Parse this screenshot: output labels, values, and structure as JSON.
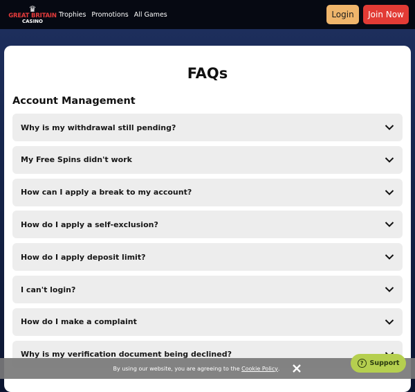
{
  "header": {
    "logo_line1": "GREAT BRITAIN",
    "logo_line2": "CASINO",
    "nav": [
      "Trophies",
      "Promotions",
      "All Games"
    ],
    "login": "Login",
    "join": "Join Now"
  },
  "main": {
    "title": "FAQs",
    "section": "Account Management",
    "faqs": [
      "Why is my withdrawal still pending?",
      "My Free Spins didn't work",
      "How can I apply a break to my account?",
      "How do I apply a self-exclusion?",
      "How do I apply deposit limit?",
      "I can't login?",
      "How do I make a complaint",
      "Why is my verification document being declined?"
    ]
  },
  "cookie": {
    "text": "By using our website, you are agreeing to the ",
    "link": "Cookie Policy",
    "end": "."
  },
  "support": {
    "label": "Support",
    "icon": "?"
  },
  "colors": {
    "login": "#efb56b",
    "join": "#e23b35",
    "support": "#b5cf4f"
  }
}
